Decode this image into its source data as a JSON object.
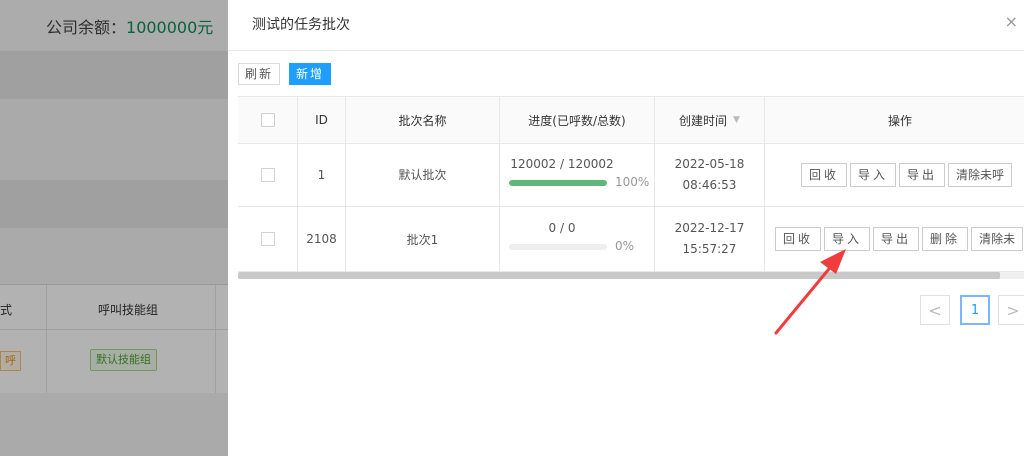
{
  "background": {
    "balance_label": "公司余额：",
    "balance_value": "1000000元",
    "table_headers": [
      "模式",
      "呼叫技能组"
    ],
    "row": {
      "mode_tag": "呼",
      "skill_group_tag": "默认技能组"
    }
  },
  "modal": {
    "title": "测试的任务批次",
    "close_icon": "×",
    "toolbar": {
      "refresh_label": "刷新",
      "add_label": "新增"
    },
    "table": {
      "headers": {
        "id": "ID",
        "name": "批次名称",
        "progress": "进度(已呼数/总数)",
        "created": "创建时间",
        "sort_icon": "▼",
        "ops": "操作"
      },
      "rows": [
        {
          "id": "1",
          "name": "默认批次",
          "progress_text": "120002 / 120002",
          "progress_fraction": 1.0,
          "progress_pct": "100%",
          "created_date": "2022-05-18",
          "created_time": "08:46:53",
          "ops": [
            "回收",
            "导入",
            "导出",
            "清除未呼"
          ]
        },
        {
          "id": "2108",
          "name": "批次1",
          "progress_text": "0 / 0",
          "progress_fraction": 0.0,
          "progress_pct": "0%",
          "created_date": "2022-12-17",
          "created_time": "15:57:27",
          "ops": [
            "回收",
            "导入",
            "导出",
            "删除",
            "清除未"
          ]
        }
      ]
    },
    "pagination": {
      "prev": "<",
      "current": "1",
      "next": ">"
    },
    "annotation": {
      "color": "#f03c3c"
    }
  }
}
